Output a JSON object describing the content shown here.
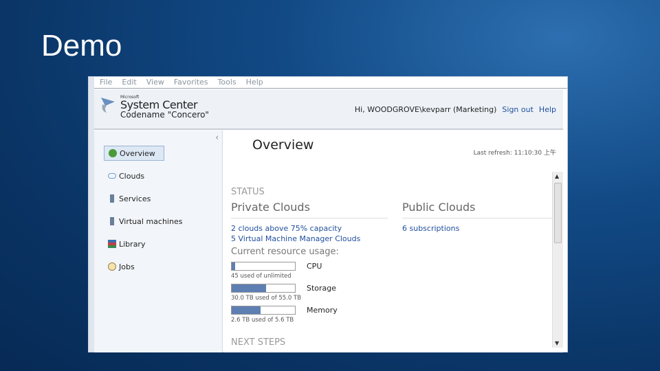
{
  "slide": {
    "title": "Demo"
  },
  "menu": [
    "File",
    "Edit",
    "View",
    "Favorites",
    "Tools",
    "Help"
  ],
  "header": {
    "logo_ms": "Microsoft",
    "logo_product": "System Center",
    "logo_codename": "Codename \"Concero\"",
    "greeting": "Hi, WOODGROVE\\kevparr (Marketing)",
    "sign_out": "Sign out",
    "help": "Help"
  },
  "sidebar": {
    "items": [
      {
        "label": "Overview"
      },
      {
        "label": "Clouds"
      },
      {
        "label": "Services"
      },
      {
        "label": "Virtual machines"
      },
      {
        "label": "Library"
      },
      {
        "label": "Jobs"
      }
    ]
  },
  "main": {
    "title": "Overview",
    "last_refresh": "Last refresh: 11:10:30 上午",
    "status": "STATUS",
    "private": {
      "title": "Private Clouds",
      "links": [
        "2 clouds above 75% capacity",
        "5 Virtual Machine Manager Clouds"
      ]
    },
    "public": {
      "title": "Public Clouds",
      "links": [
        "6 subscriptions"
      ]
    },
    "usage_title": "Current resource usage:",
    "usage": [
      {
        "label": "CPU",
        "detail": "45 used of unlimited",
        "percent": 5
      },
      {
        "label": "Storage",
        "detail": "30.0 TB used of 55.0 TB",
        "percent": 54
      },
      {
        "label": "Memory",
        "detail": "2.6 TB used of 5.6 TB",
        "percent": 46
      }
    ],
    "next_steps": "NEXT STEPS"
  },
  "colors": {
    "bar_fill": "#5e7fb2",
    "link": "#1f4e9c"
  }
}
